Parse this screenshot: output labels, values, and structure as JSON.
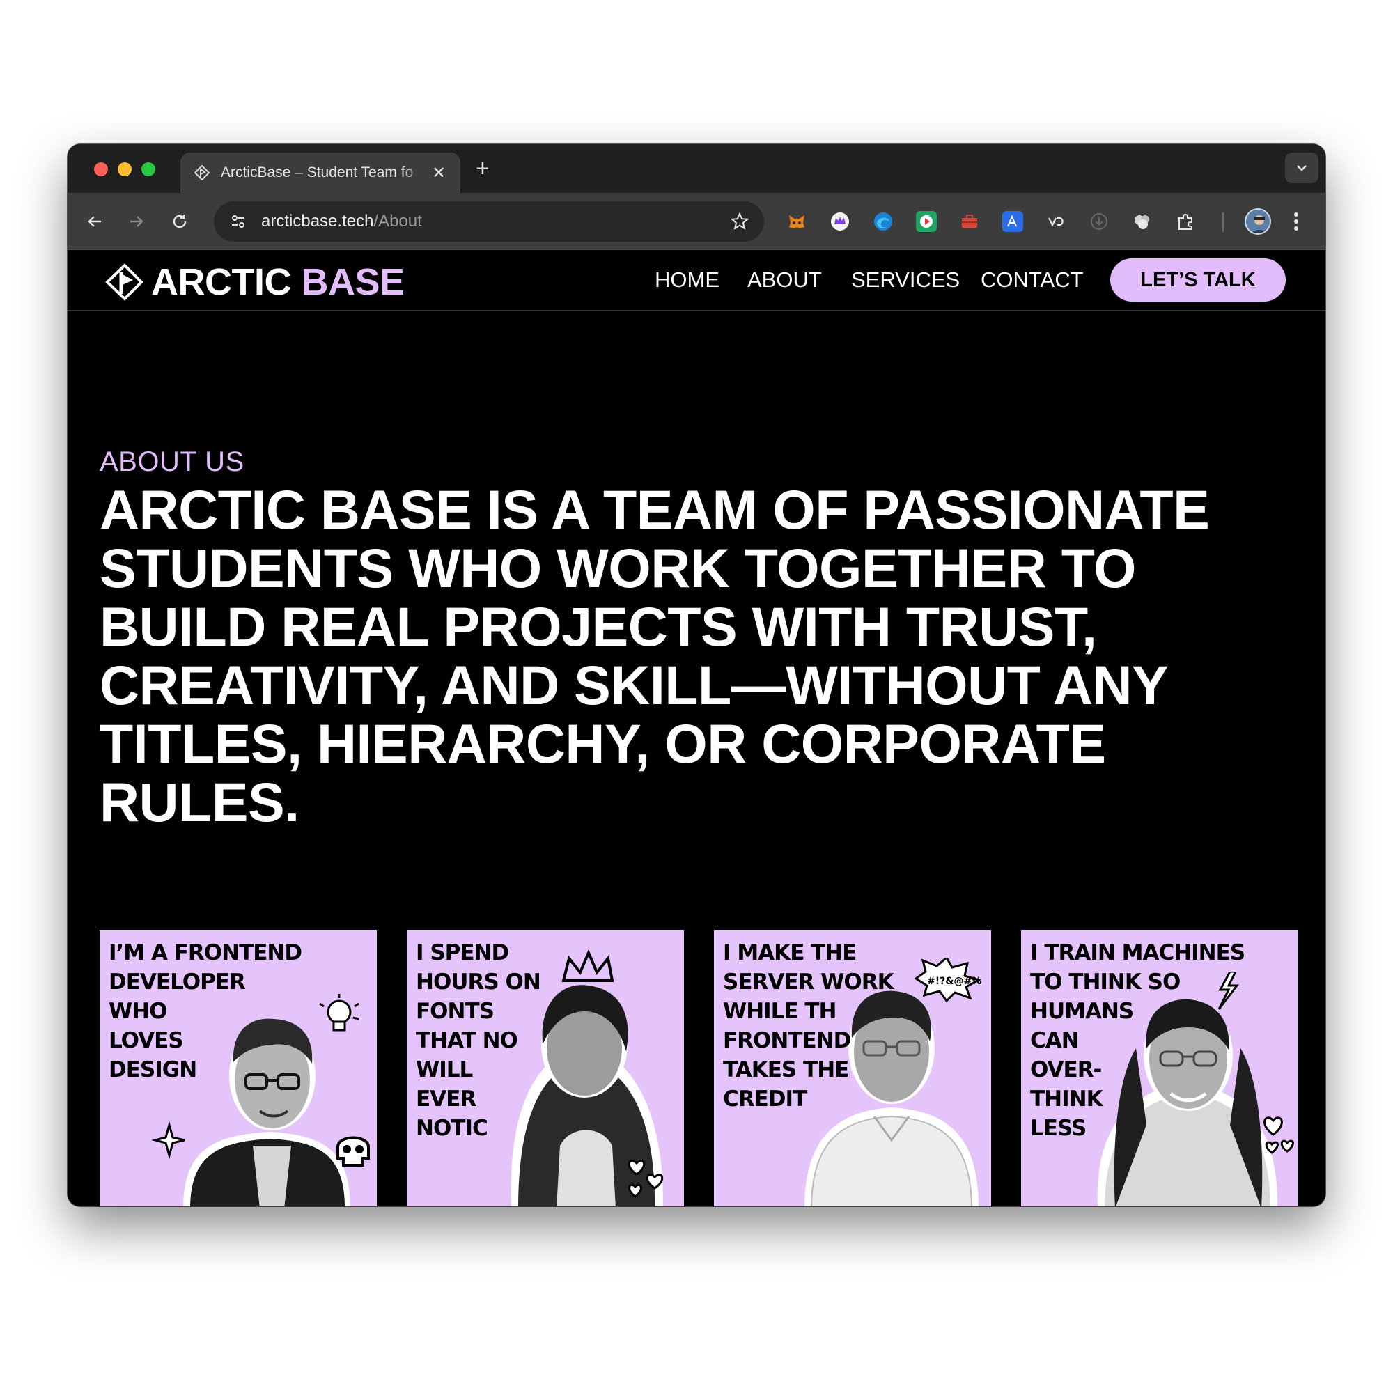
{
  "browser": {
    "tab_title": "ArcticBase – Student Team fo",
    "tab_close": "✕",
    "new_tab": "+",
    "url_host": "arcticbase.tech",
    "url_path": "/About",
    "extensions": [
      "metamask-icon",
      "crown-icon",
      "edge-icon",
      "play-icon",
      "toolbox-icon",
      "translate-icon",
      "vd-icon",
      "download-icon",
      "cloud-icon",
      "puzzle-icon"
    ]
  },
  "site": {
    "logo_part1": "ARCTIC",
    "logo_part2": "BASE",
    "nav": [
      "HOME",
      "ABOUT",
      "SERVICES",
      "CONTACT"
    ],
    "cta": "LET’S TALK",
    "accent": "#e3bdfb"
  },
  "about": {
    "eyebrow": "ABOUT US",
    "headline": [
      "ARCTIC BASE IS A TEAM OF PASSIONATE",
      "STUDENTS WHO WORK TOGETHER TO",
      "BUILD REAL PROJECTS WITH TRUST,",
      "CREATIVITY, AND SKILL—WITHOUT ANY",
      "TITLES, HIERARCHY, OR CORPORATE",
      "RULES."
    ]
  },
  "cards": [
    {
      "lines": [
        "I’M A FRONTEND",
        "DEVELOPER",
        "WHO",
        "LOVES",
        "DESIGN"
      ]
    },
    {
      "lines": [
        "I SPEND",
        "HOURS ON",
        "FONTS",
        "THAT NO",
        "WILL",
        "EVER",
        "NOTIC"
      ]
    },
    {
      "lines": [
        "I MAKE THE",
        "SERVER WORK",
        "WHILE TH",
        "FRONTEND",
        "TAKES THE",
        "CREDIT"
      ]
    },
    {
      "lines": [
        "I TRAIN MACHINES",
        "TO THINK SO",
        "HUMANS",
        "CAN",
        "OVER-",
        "THINK",
        "LESS"
      ]
    }
  ],
  "card_doodles": {
    "card1": "#!?&@#%"
  }
}
